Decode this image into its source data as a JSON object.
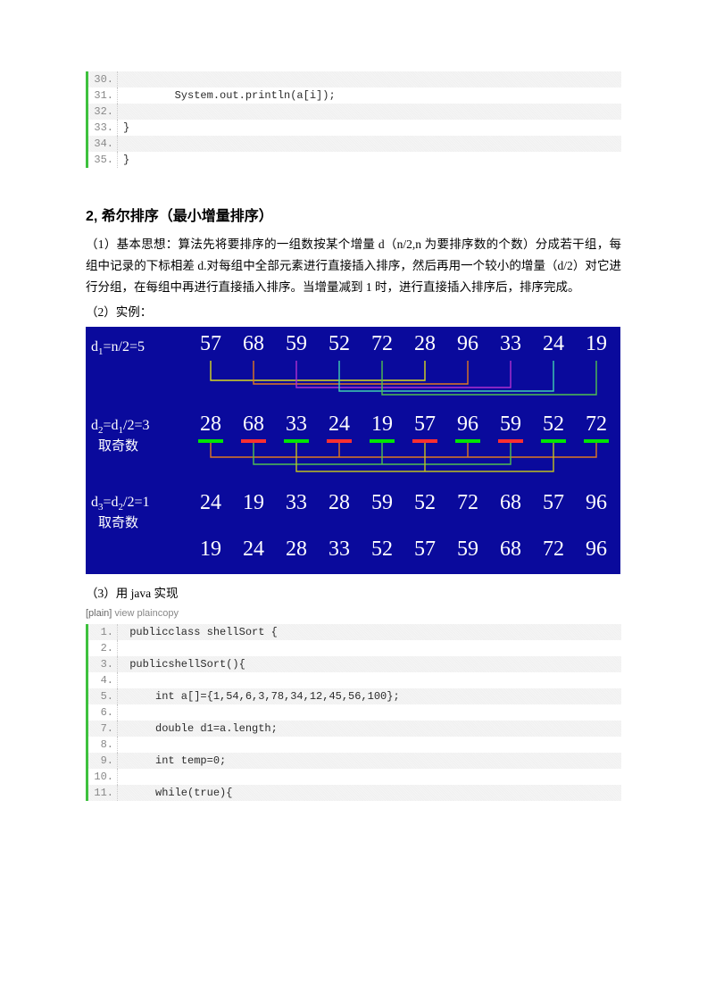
{
  "code1": {
    "lines": [
      {
        "n": "30.",
        "src": ""
      },
      {
        "n": "31.",
        "src": "        System.out.println(a[i]);"
      },
      {
        "n": "32.",
        "src": ""
      },
      {
        "n": "33.",
        "src": "}"
      },
      {
        "n": "34.",
        "src": ""
      },
      {
        "n": "35.",
        "src": "}"
      }
    ]
  },
  "section": {
    "title": "2,   希尔排序（最小增量排序）",
    "p1": "（1）基本思想：算法先将要排序的一组数按某个增量 d（n/2,n 为要排序数的个数）分成若干组，每组中记录的下标相差 d.对每组中全部元素进行直接插入排序，然后再用一个较小的增量（d/2）对它进行分组，在每组中再进行直接插入排序。当增量减到 1 时，进行直接插入排序后，排序完成。",
    "p2": "（2）实例：",
    "p3": "（3）用 java 实现",
    "plain": "[plain] view plaincopy"
  },
  "diagram": {
    "label1": "d₁=n/2=5",
    "label2a": "d₂=d₁/2=3",
    "label2b": "取奇数",
    "label3a": "d₃=d₂/2=1",
    "label3b": "取奇数",
    "row1": [
      "57",
      "68",
      "59",
      "52",
      "72",
      "28",
      "96",
      "33",
      "24",
      "19"
    ],
    "row2": [
      "28",
      "68",
      "33",
      "24",
      "19",
      "57",
      "96",
      "59",
      "52",
      "72"
    ],
    "row3": [
      "24",
      "19",
      "33",
      "28",
      "59",
      "52",
      "72",
      "68",
      "57",
      "96"
    ],
    "row4": [
      "19",
      "24",
      "28",
      "33",
      "52",
      "57",
      "59",
      "68",
      "72",
      "96"
    ],
    "row2_colors": [
      "g",
      "r",
      "g",
      "r",
      "g",
      "r",
      "g",
      "r",
      "g",
      "g"
    ]
  },
  "code2": {
    "lines": [
      {
        "n": "1.",
        "src": " publicclass shellSort {"
      },
      {
        "n": "2.",
        "src": ""
      },
      {
        "n": "3.",
        "src": " publicshellSort(){"
      },
      {
        "n": "4.",
        "src": ""
      },
      {
        "n": "5.",
        "src": "     int a[]={1,54,6,3,78,34,12,45,56,100};"
      },
      {
        "n": "6.",
        "src": ""
      },
      {
        "n": "7.",
        "src": "     double d1=a.length;"
      },
      {
        "n": "8.",
        "src": ""
      },
      {
        "n": "9.",
        "src": "     int temp=0;"
      },
      {
        "n": "10.",
        "src": ""
      },
      {
        "n": "11.",
        "src": "     while(true){"
      }
    ]
  }
}
